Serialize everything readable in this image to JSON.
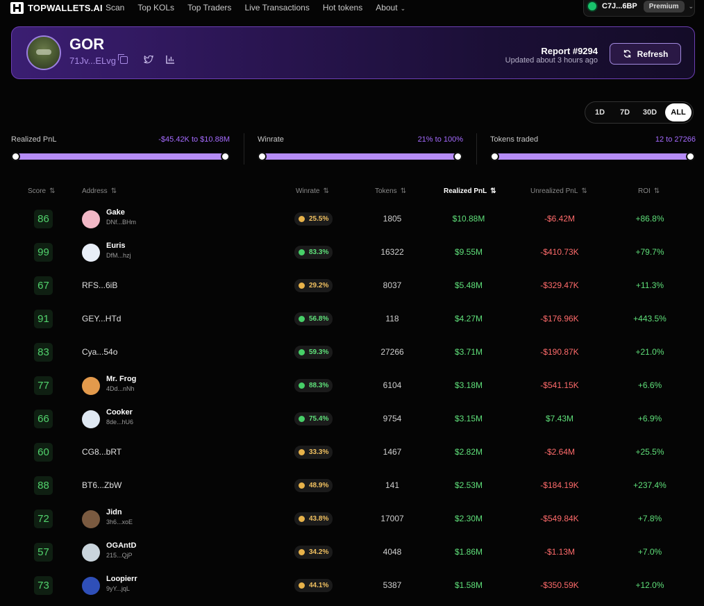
{
  "nav": {
    "logo_text": "TOPWALLETS.AI",
    "links": [
      "Scan",
      "Top KOLs",
      "Top Traders",
      "Live Transactions",
      "Hot tokens",
      "About"
    ],
    "wallet_address": "C7J...6BP",
    "wallet_badge": "Premium"
  },
  "token": {
    "name": "GOR",
    "address": "71Jv...ELvg",
    "report": "Report #9294",
    "updated": "Updated about 3 hours ago",
    "refresh_label": "Refresh"
  },
  "time_ranges": [
    "1D",
    "7D",
    "30D",
    "ALL"
  ],
  "time_range_active": "ALL",
  "filters": [
    {
      "label": "Realized PnL",
      "range": "-$45.42K to $10.88M"
    },
    {
      "label": "Winrate",
      "range": "21% to 100%"
    },
    {
      "label": "Tokens traded",
      "range": "12 to 27266"
    }
  ],
  "table": {
    "columns": [
      "Score",
      "Address",
      "Winrate",
      "Tokens",
      "Realized PnL",
      "Unrealized PnL",
      "ROI"
    ],
    "sorted_column": "Realized PnL",
    "rows": [
      {
        "score": "86",
        "name": "Gake",
        "address": "DNf...BHm",
        "winrate": "25.5%",
        "winrate_level": "mid",
        "tokens": "1805",
        "realized": "$10.88M",
        "unrealized": "-$6.42M",
        "unrealized_sign": "neg",
        "roi": "+86.8%",
        "avatar_color": "#f2b8c6"
      },
      {
        "score": "99",
        "name": "Euris",
        "address": "DfM...hzj",
        "winrate": "83.3%",
        "winrate_level": "good",
        "tokens": "16322",
        "realized": "$9.55M",
        "unrealized": "-$410.73K",
        "unrealized_sign": "neg",
        "roi": "+79.7%",
        "avatar_color": "#e8eef7"
      },
      {
        "score": "67",
        "name": "",
        "address": "RFS...6iB",
        "winrate": "29.2%",
        "winrate_level": "mid",
        "tokens": "8037",
        "realized": "$5.48M",
        "unrealized": "-$329.47K",
        "unrealized_sign": "neg",
        "roi": "+11.3%",
        "avatar_color": ""
      },
      {
        "score": "91",
        "name": "",
        "address": "GEY...HTd",
        "winrate": "56.8%",
        "winrate_level": "good",
        "tokens": "118",
        "realized": "$4.27M",
        "unrealized": "-$176.96K",
        "unrealized_sign": "neg",
        "roi": "+443.5%",
        "avatar_color": ""
      },
      {
        "score": "83",
        "name": "",
        "address": "Cya...54o",
        "winrate": "59.3%",
        "winrate_level": "good",
        "tokens": "27266",
        "realized": "$3.71M",
        "unrealized": "-$190.87K",
        "unrealized_sign": "neg",
        "roi": "+21.0%",
        "avatar_color": ""
      },
      {
        "score": "77",
        "name": "Mr. Frog",
        "address": "4Dd...nNh",
        "winrate": "88.3%",
        "winrate_level": "good",
        "tokens": "6104",
        "realized": "$3.18M",
        "unrealized": "-$541.15K",
        "unrealized_sign": "neg",
        "roi": "+6.6%",
        "avatar_color": "#e39a4c"
      },
      {
        "score": "66",
        "name": "Cooker",
        "address": "8de...hU6",
        "winrate": "75.4%",
        "winrate_level": "good",
        "tokens": "9754",
        "realized": "$3.15M",
        "unrealized": "$7.43M",
        "unrealized_sign": "pos",
        "roi": "+6.9%",
        "avatar_color": "#dfe8f2"
      },
      {
        "score": "60",
        "name": "",
        "address": "CG8...bRT",
        "winrate": "33.3%",
        "winrate_level": "mid",
        "tokens": "1467",
        "realized": "$2.82M",
        "unrealized": "-$2.64M",
        "unrealized_sign": "neg",
        "roi": "+25.5%",
        "avatar_color": ""
      },
      {
        "score": "88",
        "name": "",
        "address": "BT6...ZbW",
        "winrate": "48.9%",
        "winrate_level": "mid",
        "tokens": "141",
        "realized": "$2.53M",
        "unrealized": "-$184.19K",
        "unrealized_sign": "neg",
        "roi": "+237.4%",
        "avatar_color": ""
      },
      {
        "score": "72",
        "name": "Jidn",
        "address": "3h6...xoE",
        "winrate": "43.8%",
        "winrate_level": "mid",
        "tokens": "17007",
        "realized": "$2.30M",
        "unrealized": "-$549.84K",
        "unrealized_sign": "neg",
        "roi": "+7.8%",
        "avatar_color": "#7a5a40"
      },
      {
        "score": "57",
        "name": "OGAntD",
        "address": "215...QjP",
        "winrate": "34.2%",
        "winrate_level": "mid",
        "tokens": "4048",
        "realized": "$1.86M",
        "unrealized": "-$1.13M",
        "unrealized_sign": "neg",
        "roi": "+7.0%",
        "avatar_color": "#c9d4dc"
      },
      {
        "score": "73",
        "name": "Loopierr",
        "address": "9yY...jqL",
        "winrate": "44.1%",
        "winrate_level": "mid",
        "tokens": "5387",
        "realized": "$1.58M",
        "unrealized": "-$350.59K",
        "unrealized_sign": "neg",
        "roi": "+12.0%",
        "avatar_color": "#2f4fb8"
      }
    ]
  }
}
